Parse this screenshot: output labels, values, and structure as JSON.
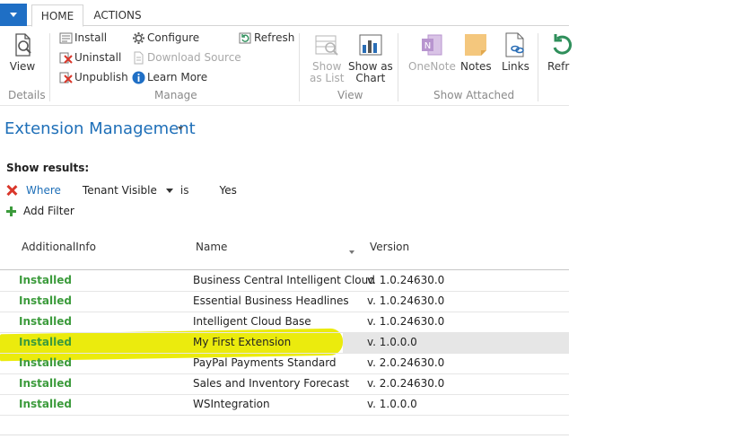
{
  "ribbon_tabs": {
    "home": "HOME",
    "actions": "ACTIONS"
  },
  "ribbon": {
    "details": {
      "view": "View",
      "group": "Details"
    },
    "manage": {
      "install": "Install",
      "uninstall": "Uninstall",
      "unpublish": "Unpublish",
      "configure": "Configure",
      "download_source": "Download Source",
      "learn_more": "Learn More",
      "refresh": "Refresh",
      "group": "Manage"
    },
    "view": {
      "show_as_list_1": "Show",
      "show_as_list_2": "as List",
      "show_as_chart_1": "Show as",
      "show_as_chart_2": "Chart",
      "group": "View"
    },
    "show_attached": {
      "onenote": "OneNote",
      "notes": "Notes",
      "links": "Links",
      "group": "Show Attached"
    },
    "refresh_cut": "Refr"
  },
  "page_title": "Extension Management",
  "filters": {
    "show_results": "Show results:",
    "where": "Where",
    "field": "Tenant Visible",
    "operator": "is",
    "value": "Yes",
    "add_filter": "Add Filter"
  },
  "table": {
    "columns": [
      "AdditionalInfo",
      "Name",
      "Version"
    ],
    "rows": [
      {
        "info": "Installed",
        "name": "Business Central Intelligent Cloud",
        "version": "v. 1.0.24630.0"
      },
      {
        "info": "Installed",
        "name": "Essential Business Headlines",
        "version": "v. 1.0.24630.0"
      },
      {
        "info": "Installed",
        "name": "Intelligent Cloud Base",
        "version": "v. 1.0.24630.0"
      },
      {
        "info": "Installed",
        "name": "My First Extension",
        "version": "v. 1.0.0.0"
      },
      {
        "info": "Installed",
        "name": "PayPal Payments Standard",
        "version": "v. 2.0.24630.0"
      },
      {
        "info": "Installed",
        "name": "Sales and Inventory Forecast",
        "version": "v. 2.0.24630.0"
      },
      {
        "info": "Installed",
        "name": "WSIntegration",
        "version": "v. 1.0.0.0"
      }
    ]
  },
  "colors": {
    "accent": "#1e6fb8",
    "installed": "#3c9b3c",
    "highlight": "#eaea00",
    "selected_row": "#e6e6e6"
  }
}
